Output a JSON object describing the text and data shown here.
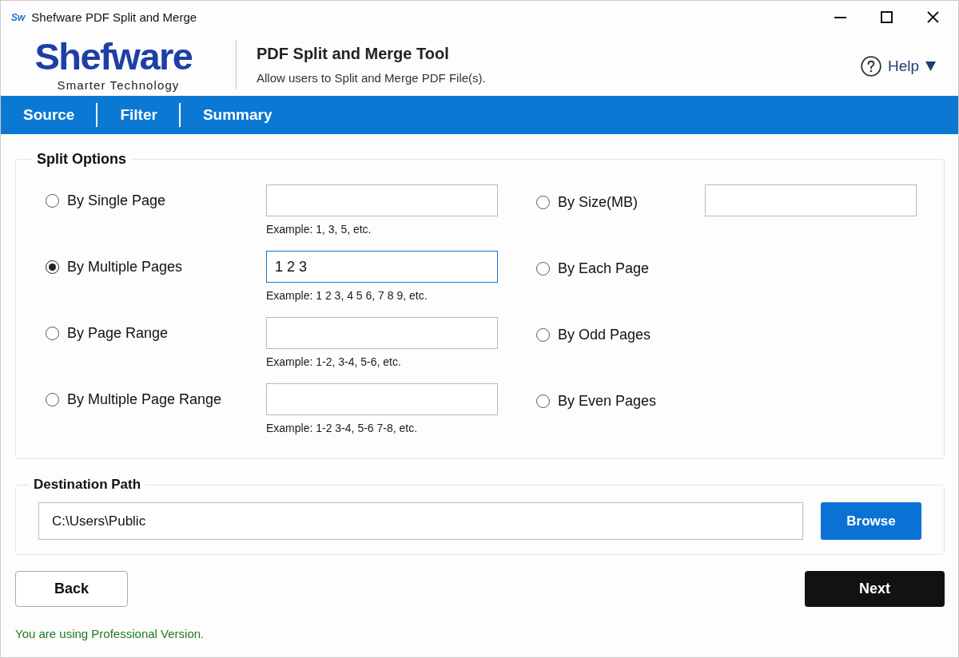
{
  "window": {
    "icon_text": "Sw",
    "title": "Shefware PDF Split and Merge"
  },
  "header": {
    "logo": "Shefware",
    "tagline": "Smarter Technology",
    "title": "PDF Split and Merge Tool",
    "subtitle": "Allow users to Split and Merge PDF File(s).",
    "help": "Help"
  },
  "tabs": [
    {
      "label": "Source"
    },
    {
      "label": "Filter"
    },
    {
      "label": "Summary"
    }
  ],
  "split_options": {
    "title": "Split Options",
    "left_options": [
      {
        "kind": "field",
        "label": "By Single Page",
        "selected": false,
        "focused": false,
        "hint": "Example: 1, 3, 5, etc."
      },
      {
        "kind": "field",
        "label": "By Multiple Pages",
        "selected": true,
        "focused": true,
        "value": "1 2 3",
        "hint": "Example: 1 2 3, 4 5 6, 7 8 9, etc."
      },
      {
        "kind": "field",
        "label": "By Page Range",
        "selected": false,
        "focused": false,
        "hint": "Example: 1-2, 3-4, 5-6, etc."
      },
      {
        "kind": "field",
        "label": "By Multiple Page Range",
        "selected": false,
        "focused": false,
        "hint": "Example: 1-2 3-4, 5-6 7-8, etc."
      }
    ],
    "right_options": [
      {
        "kind": "field",
        "label": "By Size(MB)",
        "selected": false,
        "focused": false
      },
      {
        "kind": "plain",
        "label": "By Each Page",
        "selected": false
      },
      {
        "kind": "plain",
        "label": "By Odd Pages",
        "selected": false
      },
      {
        "kind": "plain",
        "label": "By Even Pages",
        "selected": false
      }
    ]
  },
  "destination": {
    "title": "Destination Path",
    "path": "C:\\Users\\Public",
    "button": "Browse"
  },
  "buttons": {
    "back": "Back",
    "next": "Next"
  },
  "status": "You are using Professional Version."
}
